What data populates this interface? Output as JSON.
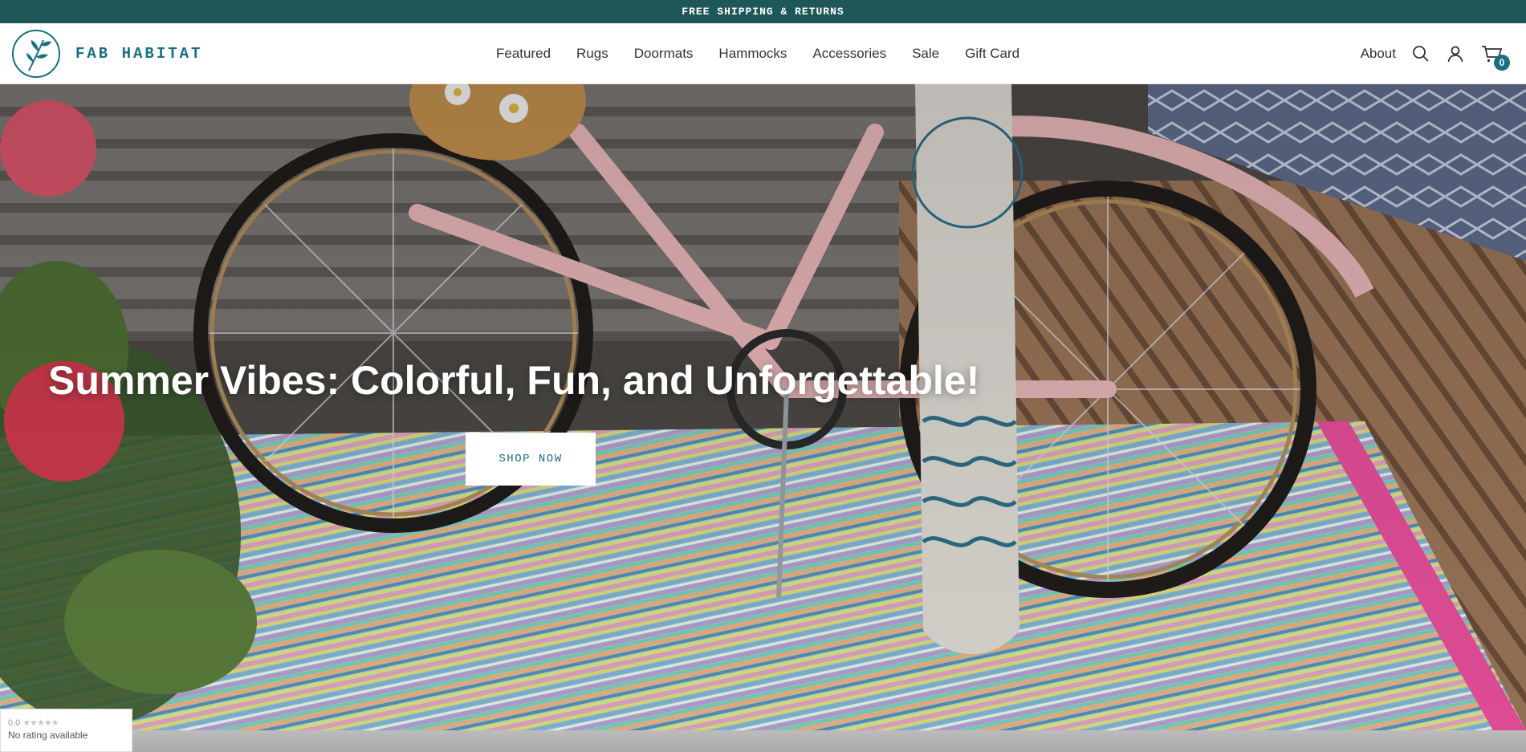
{
  "announcement": {
    "text": "FREE SHIPPING & RETURNS"
  },
  "header": {
    "brand_name": "FAB HABITAT",
    "nav": [
      {
        "label": "Featured"
      },
      {
        "label": "Rugs"
      },
      {
        "label": "Doormats"
      },
      {
        "label": "Hammocks"
      },
      {
        "label": "Accessories"
      },
      {
        "label": "Sale"
      },
      {
        "label": "Gift Card"
      }
    ],
    "about_label": "About",
    "icons": {
      "search": "search-icon",
      "account": "user-icon",
      "cart": "cart-icon"
    },
    "cart_count": "0"
  },
  "hero": {
    "title": "Summer Vibes: Colorful, Fun, and Unforgettable!",
    "cta_label": "SHOP NOW"
  },
  "rating_widget": {
    "score": "0.0",
    "stars": "★★★★★",
    "text": "No rating available"
  },
  "colors": {
    "announcement_bg": "#1f5758",
    "brand": "#1b6f82",
    "text": "#333333"
  }
}
